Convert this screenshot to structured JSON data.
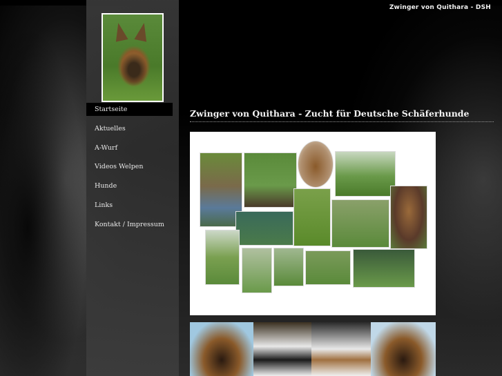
{
  "site": {
    "name": "Zwinger von Quithara - DSH"
  },
  "logo": {
    "alt": "german-shepherd-portrait"
  },
  "nav": {
    "items": [
      {
        "label": "Startseite",
        "active": true
      },
      {
        "label": "Aktuelles"
      },
      {
        "label": "A-Wurf"
      },
      {
        "label": "Videos Welpen"
      },
      {
        "label": "Hunde"
      },
      {
        "label": "Links"
      },
      {
        "label": "Kontakt / Impressum"
      }
    ]
  },
  "main": {
    "headline": "Zwinger von Quithara  -  Zucht für Deutsche Schäferhunde"
  },
  "colors": {
    "accent_text": "#f4f4f4",
    "sidebar": "#333333",
    "background": "#000000"
  }
}
